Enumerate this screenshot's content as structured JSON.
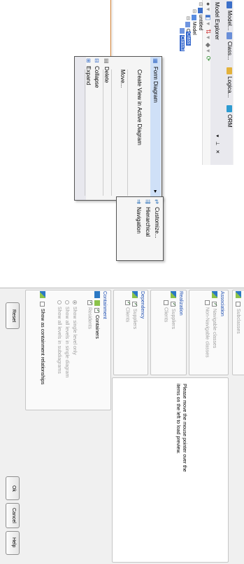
{
  "explorer": {
    "tabs": [
      "Model...",
      "Class...",
      "Logica...",
      "ORM"
    ],
    "panel_title": "Model Explorer",
    "panel_controls": [
      "▾",
      "⊥",
      "✕"
    ],
    "tree": {
      "root": "untitled",
      "model": "Model",
      "class": "Class",
      "class1": "Class",
      "class3": "Class3"
    }
  },
  "context_menu": {
    "items": [
      "Form Diagram",
      "Create View in Active Diagram",
      "Move...",
      "Delete",
      "Collapse",
      "Expand"
    ],
    "submenu_arrow": "▸"
  },
  "submenu": {
    "items": [
      "Customize...",
      "Hierarchical",
      "Navigation"
    ]
  },
  "dialog": {
    "subclasses": "Subclasses",
    "association": {
      "header": "Association",
      "items": [
        "Navigable classes",
        "Non-Navigable classes"
      ]
    },
    "realization": {
      "header": "Realization",
      "items": [
        "Suppliers",
        "Clients"
      ]
    },
    "dependency": {
      "header": "Dependency",
      "items": [
        "Suppliers",
        "Clients"
      ]
    },
    "containment": {
      "header": "Containment",
      "containers": "Containers",
      "residents": "Residents",
      "radios": [
        "Show single level only",
        "Show all levels in single diagram",
        "Show all levels in subdiagrams"
      ],
      "show_relationships": "Show as containment relationships"
    },
    "preview_text": [
      "Please move the mouse pointer over the",
      "items on the left to load preview."
    ],
    "buttons": {
      "reset": "Reset",
      "ok": "Ok",
      "cancel": "Cancel",
      "help": "Help"
    }
  },
  "colors": {
    "accent": "#1f4fb3",
    "title_orange": "#f4b46a",
    "tree_selection": "#3366cc"
  }
}
